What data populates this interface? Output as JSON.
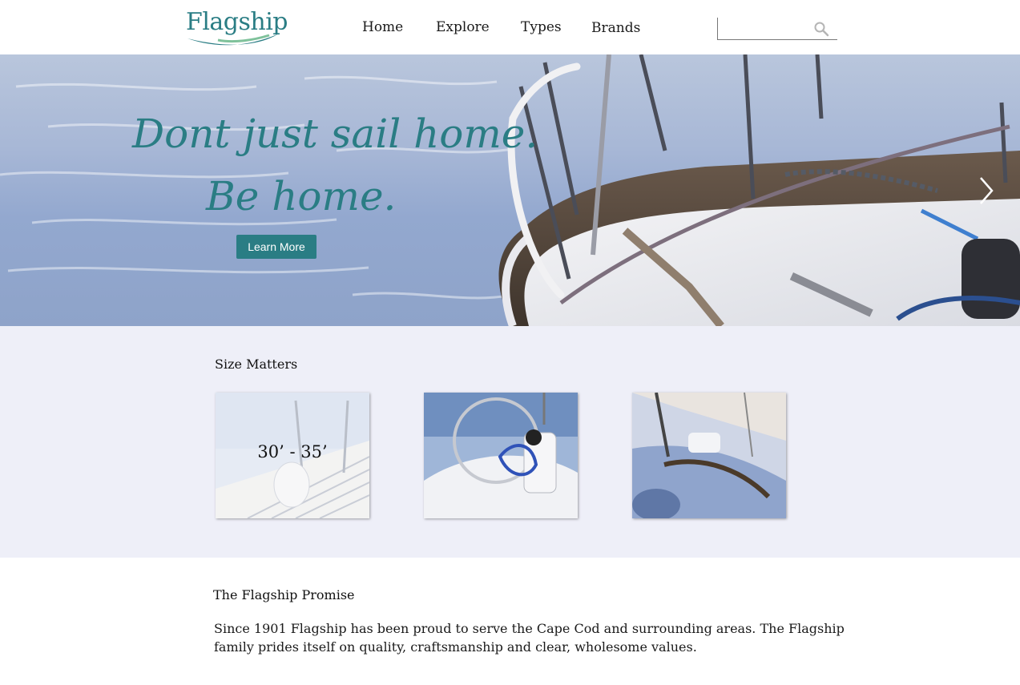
{
  "brand": {
    "name": "Flagship",
    "color": "#2a7d84"
  },
  "nav": {
    "items": [
      {
        "label": "Home"
      },
      {
        "label": "Explore"
      },
      {
        "label": "Types"
      },
      {
        "label": "Brands"
      }
    ]
  },
  "search": {
    "value": "",
    "placeholder": "",
    "icon": "search-icon"
  },
  "hero": {
    "line1": "Dont just sail home.",
    "line2": "Be home.",
    "cta_label": "Learn More",
    "next_icon": "chevron-right-icon"
  },
  "size_section": {
    "title": "Size Matters",
    "cards": [
      {
        "label": "30’ - 35’"
      },
      {
        "label": ""
      },
      {
        "label": ""
      }
    ]
  },
  "promise": {
    "title": "The Flagship Promise",
    "body": "Since 1901 Flagship has been proud to serve the Cape Cod and surrounding areas. The Flagship family prides itself on quality, craftsmanship and clear,  wholesome values."
  }
}
